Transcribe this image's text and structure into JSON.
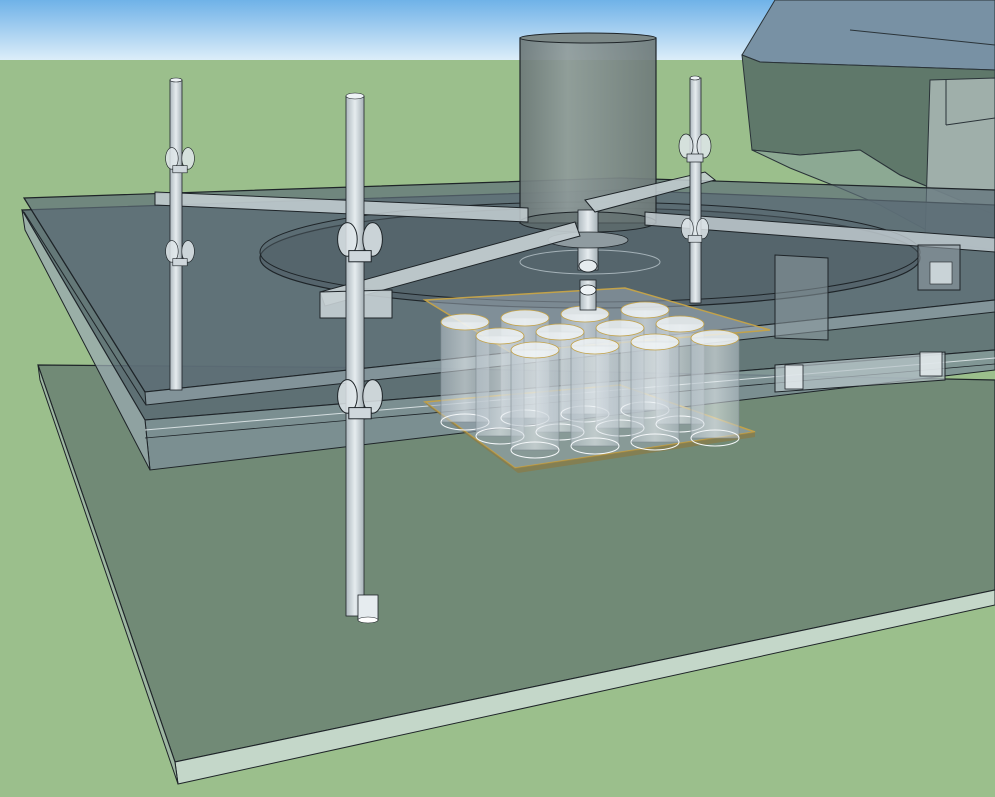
{
  "scene": {
    "kind": "sketchup-3d-model",
    "style": "x-ray transparent faces with black edges",
    "colors": {
      "sky_top": "#6fb2e8",
      "sky_bottom": "#d9ecf8",
      "ground": "#9bbf8c",
      "edge": "#1e2428",
      "plate_fill": "#5b6a73",
      "glass_edge": "#c9d6d6",
      "rod_fill": "#cfd7dc",
      "tube_fill": "#eef3f6",
      "tray_outline": "#c2a24a"
    },
    "components": [
      {
        "name": "base-slab"
      },
      {
        "name": "lower-glass-plate"
      },
      {
        "name": "upper-glass-plate"
      },
      {
        "name": "rotating-disc"
      },
      {
        "name": "motor-cylinder"
      },
      {
        "name": "cross-arms"
      },
      {
        "name": "threaded-rods",
        "count": 3
      },
      {
        "name": "wing-nuts",
        "count": 6
      },
      {
        "name": "test-tube-rack",
        "rows": 3,
        "cols": 4
      },
      {
        "name": "side-bracket"
      },
      {
        "name": "background-machine"
      }
    ]
  }
}
